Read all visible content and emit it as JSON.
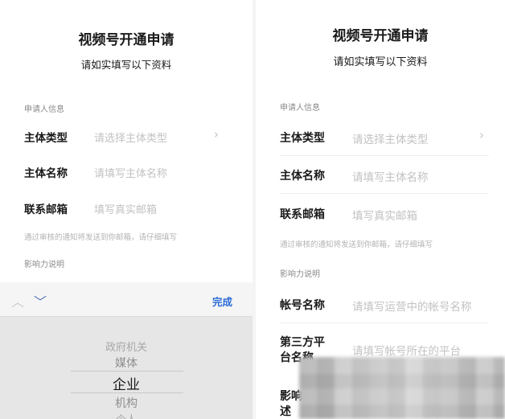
{
  "left": {
    "title": "视频号开通申请",
    "subtitle": "请如实填写以下资料",
    "section_applicant": "申请人信息",
    "rows": [
      {
        "label": "主体类型",
        "placeholder": "请选择主体类型",
        "chevron": "›"
      },
      {
        "label": "主体名称",
        "placeholder": "请填写主体名称"
      },
      {
        "label": "联系邮箱",
        "placeholder": "填写真实邮箱"
      }
    ],
    "email_hint": "通过审核的通知将发送到你邮箱，请仔细填写",
    "section_influence": "影响力说明",
    "picker": {
      "up_icon": "︿",
      "down_icon": "﹀",
      "done_label": "完成",
      "options": [
        "政府机关",
        "媒体",
        "企业",
        "机构",
        "个人"
      ],
      "selected": "企业"
    }
  },
  "right": {
    "title": "视频号开通申请",
    "subtitle": "请如实填写以下资料",
    "section_applicant": "申请人信息",
    "rows": [
      {
        "label": "主体类型",
        "placeholder": "请选择主体类型",
        "chevron": "›"
      },
      {
        "label": "主体名称",
        "placeholder": "请填写主体名称"
      },
      {
        "label": "联系邮箱",
        "placeholder": "填写真实邮箱"
      }
    ],
    "email_hint": "通过审核的通知将发送到你邮箱，请仔细填写",
    "section_influence": "影响力说明",
    "influence_rows": [
      {
        "label": "帐号名称",
        "placeholder": "请填写运营中的帐号名称"
      },
      {
        "label_line1": "第三方平",
        "label_line2": "台名称",
        "placeholder": "请填写帐号所在的平台"
      },
      {
        "label_line1": "影响",
        "label_line2": "述"
      }
    ]
  }
}
